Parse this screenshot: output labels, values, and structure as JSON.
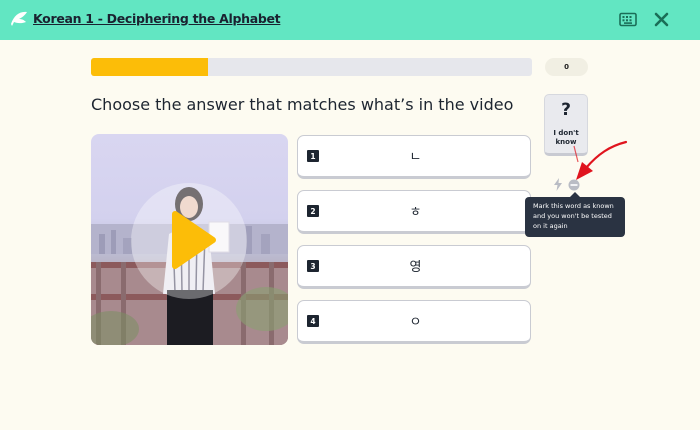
{
  "header": {
    "course_title": "Korean 1 - Deciphering the Alphabet"
  },
  "progress": {
    "fraction": 0.265,
    "score": "0",
    "fill_color": "#fcbd08"
  },
  "question": {
    "prompt": "Choose the answer that matches what’s in the video"
  },
  "options": [
    {
      "number": "1",
      "text": "ㄴ"
    },
    {
      "number": "2",
      "text": "ㅎ"
    },
    {
      "number": "3",
      "text": "영"
    },
    {
      "number": "4",
      "text": "ㅇ"
    }
  ],
  "sidebar": {
    "dont_know_symbol": "?",
    "dont_know_label": "I don't know",
    "tooltip_text": "Mark this word as known and you won't be tested on it again"
  },
  "colors": {
    "topbar": "#62e6c2",
    "accent_dark": "#1d2530",
    "annotation_red": "#e0141e"
  },
  "icons": {
    "logo": "bee-logo-icon",
    "keyboard": "keyboard-icon",
    "close": "close-icon",
    "play": "play-icon",
    "bolt": "bolt-icon",
    "ignore": "ignore-minus-icon"
  }
}
